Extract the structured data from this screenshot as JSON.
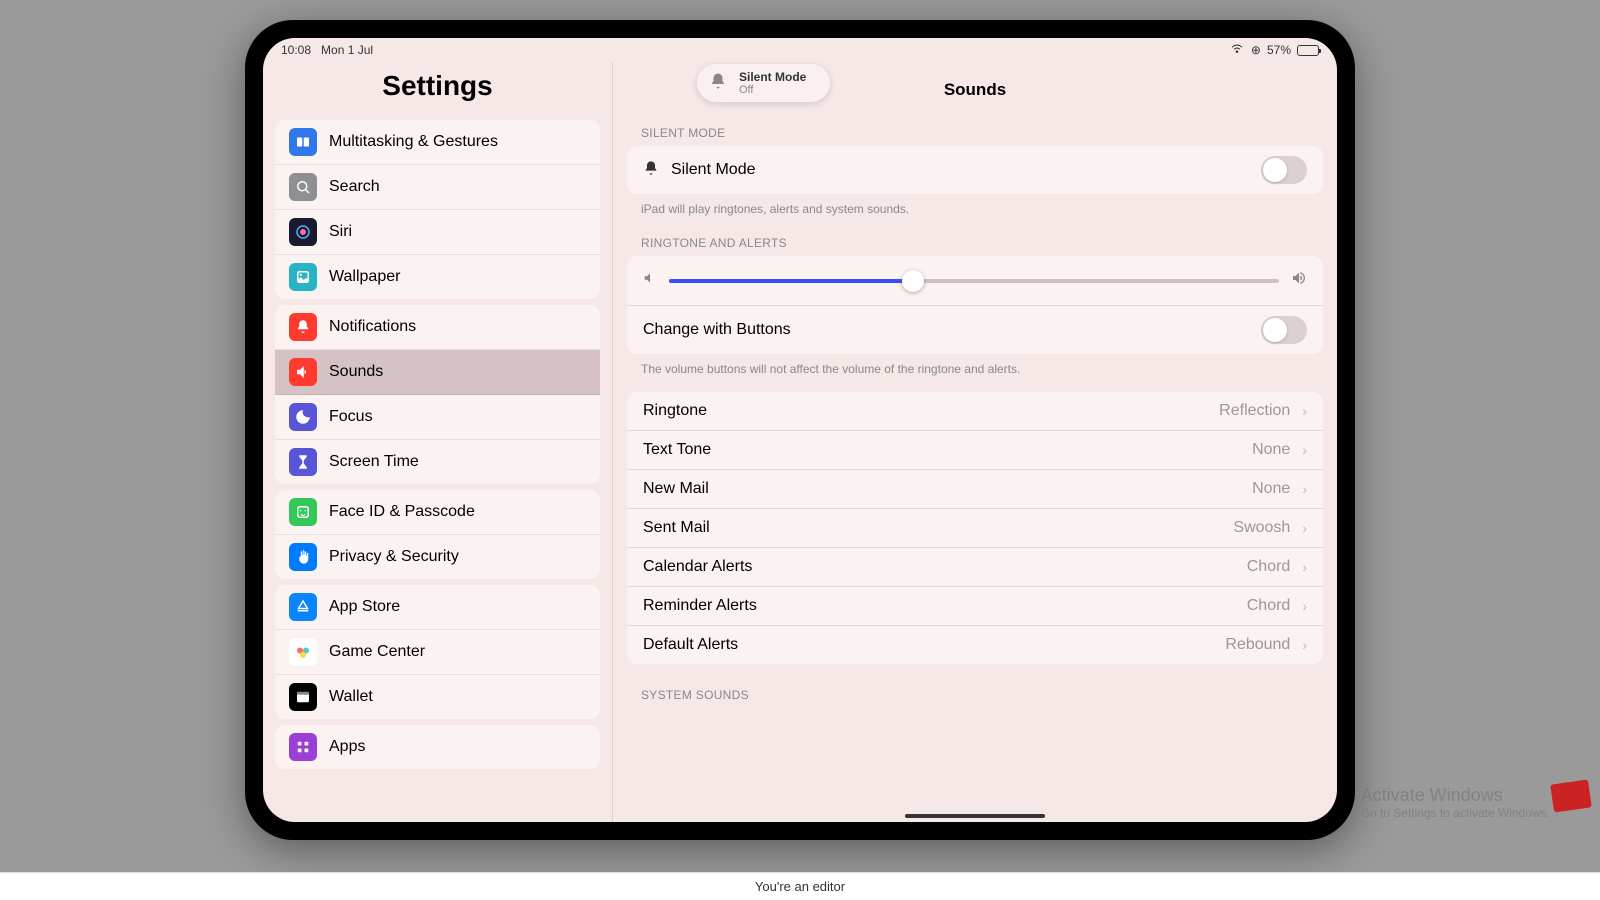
{
  "status": {
    "time": "10:08",
    "date": "Mon 1 Jul",
    "battery": "57%"
  },
  "notification": {
    "title": "Silent Mode",
    "subtitle": "Off"
  },
  "sidebar": {
    "title": "Settings",
    "groups": [
      [
        {
          "label": "Multitasking & Gestures",
          "color": "#3277ea",
          "icon": "multitask"
        },
        {
          "label": "Search",
          "color": "#8e8e93",
          "icon": "search"
        },
        {
          "label": "Siri",
          "color": "#1a1a2e",
          "icon": "siri"
        },
        {
          "label": "Wallpaper",
          "color": "#28b4c4",
          "icon": "wallpaper"
        }
      ],
      [
        {
          "label": "Notifications",
          "color": "#ff3b30",
          "icon": "bell"
        },
        {
          "label": "Sounds",
          "color": "#ff3b30",
          "icon": "speaker",
          "selected": true
        },
        {
          "label": "Focus",
          "color": "#5856d6",
          "icon": "moon"
        },
        {
          "label": "Screen Time",
          "color": "#5856d6",
          "icon": "hourglass"
        }
      ],
      [
        {
          "label": "Face ID & Passcode",
          "color": "#34c759",
          "icon": "faceid"
        },
        {
          "label": "Privacy & Security",
          "color": "#007aff",
          "icon": "hand"
        }
      ],
      [
        {
          "label": "App Store",
          "color": "#0a84ff",
          "icon": "appstore"
        },
        {
          "label": "Game Center",
          "color": "#fff",
          "icon": "gamecenter"
        },
        {
          "label": "Wallet",
          "color": "#000",
          "icon": "wallet"
        }
      ],
      [
        {
          "label": "Apps",
          "color": "#9b3fd6",
          "icon": "apps"
        }
      ]
    ]
  },
  "detail": {
    "title": "Sounds",
    "silentSection": {
      "header": "SILENT MODE",
      "rowLabel": "Silent Mode",
      "footer": "iPad will play ringtones, alerts and system sounds."
    },
    "ringtoneSection": {
      "header": "RINGTONE AND ALERTS",
      "changeButtons": "Change with Buttons",
      "footer": "The volume buttons will not affect the volume of the ringtone and alerts."
    },
    "soundRows": [
      {
        "label": "Ringtone",
        "value": "Reflection"
      },
      {
        "label": "Text Tone",
        "value": "None"
      },
      {
        "label": "New Mail",
        "value": "None"
      },
      {
        "label": "Sent Mail",
        "value": "Swoosh"
      },
      {
        "label": "Calendar Alerts",
        "value": "Chord"
      },
      {
        "label": "Reminder Alerts",
        "value": "Chord"
      },
      {
        "label": "Default Alerts",
        "value": "Rebound"
      }
    ],
    "systemHeader": "SYSTEM SOUNDS"
  },
  "watermark": {
    "title": "Activate Windows",
    "sub": "Go to Settings to activate Windows."
  },
  "editor": "You're an editor"
}
